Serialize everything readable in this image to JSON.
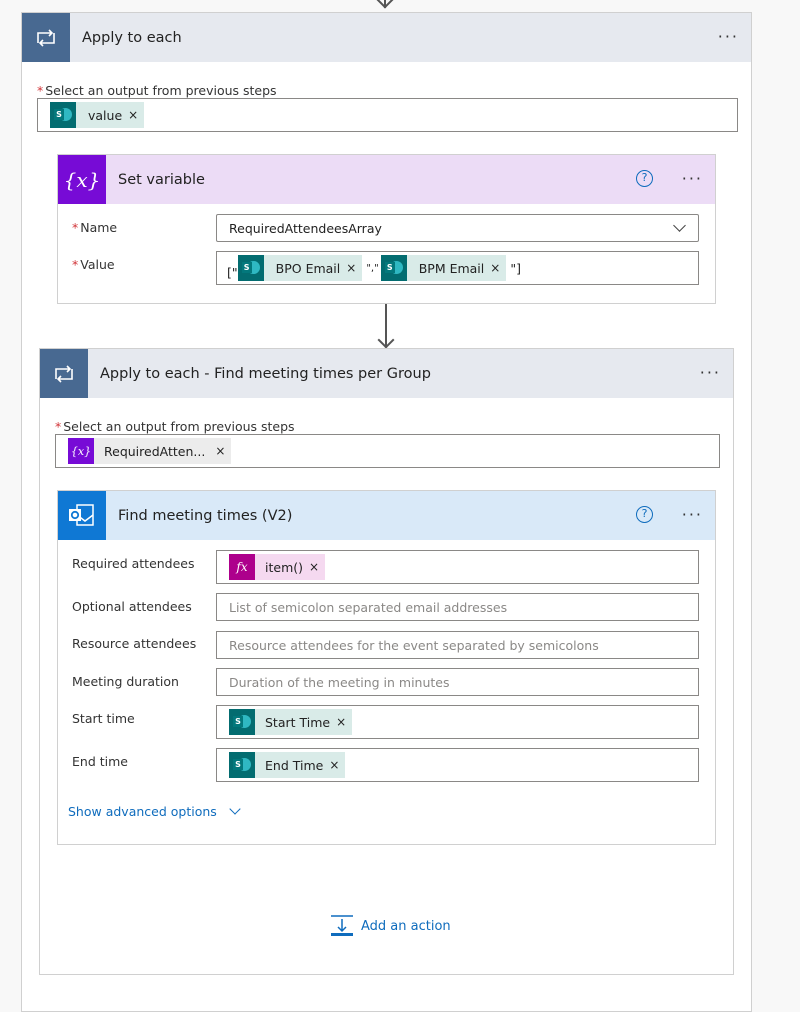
{
  "apply_each": {
    "title": "Apply to each",
    "select_label": "Select an output from previous steps",
    "token": "value"
  },
  "set_variable": {
    "title": "Set variable",
    "name_label": "Name",
    "name_value": "RequiredAttendeesArray",
    "value_label": "Value",
    "value_prefix": "[\"",
    "token1": "BPO Email",
    "separator": "\",\"",
    "token2": "BPM Email",
    "value_suffix": "\"]"
  },
  "apply_each_inner": {
    "title": "Apply to each - Find meeting times per Group",
    "select_label": "Select an output from previous steps",
    "token": "RequiredAtten..."
  },
  "find_meeting": {
    "title": "Find meeting times (V2)",
    "required_label": "Required attendees",
    "required_token": "item()",
    "optional_label": "Optional attendees",
    "optional_placeholder": "List of semicolon separated email addresses",
    "resource_label": "Resource attendees",
    "resource_placeholder": "Resource attendees for the event separated by semicolons",
    "duration_label": "Meeting duration",
    "duration_placeholder": "Duration of the meeting in minutes",
    "start_label": "Start time",
    "start_token": "Start Time",
    "end_label": "End time",
    "end_token": "End Time",
    "advanced": "Show advanced options"
  },
  "add_action": "Add an action",
  "more": "···",
  "help": "?",
  "close": "×",
  "colors": {
    "loop": "#486991",
    "variable": "#770bd6",
    "outlook": "#0f78d4",
    "expression": "#ad008c"
  }
}
